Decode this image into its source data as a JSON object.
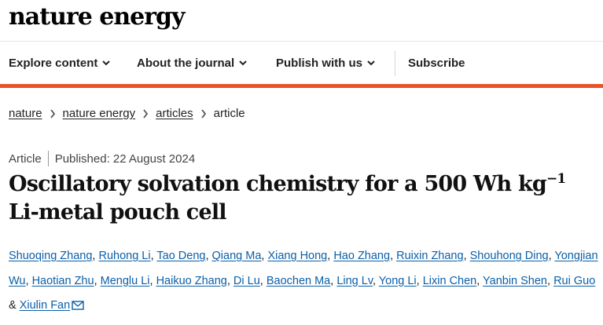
{
  "brand": {
    "logo_text": "nature energy"
  },
  "nav": {
    "items": [
      {
        "label": "Explore content",
        "has_dropdown": true
      },
      {
        "label": "About the journal",
        "has_dropdown": true
      },
      {
        "label": "Publish with us",
        "has_dropdown": true
      }
    ],
    "subscribe_label": "Subscribe"
  },
  "colors": {
    "accent": "#e8532a",
    "link": "#0c5fa8"
  },
  "breadcrumb": {
    "links": [
      "nature",
      "nature energy",
      "articles"
    ],
    "current": "article"
  },
  "article": {
    "type": "Article",
    "published": "Published: 22 August 2024",
    "title_main": "Oscillatory solvation chemistry for a 500 Wh kg",
    "title_sup": "−1",
    "title_tail": " Li-metal pouch cell",
    "authors": [
      "Shuoqing Zhang",
      "Ruhong Li",
      "Tao Deng",
      "Qiang Ma",
      "Xiang Hong",
      "Hao Zhang",
      "Ruixin Zhang",
      "Shouhong Ding",
      "Yongjian Wu",
      "Haotian Zhu",
      "Menglu Li",
      "Haikuo Zhang",
      "Di Lu",
      "Baochen Ma",
      "Ling Lv",
      "Yong Li",
      "Lixin Chen",
      "Yanbin Shen",
      "Rui Guo",
      "Xiulin Fan"
    ],
    "author_separator": ", ",
    "last_separator": " & ",
    "corresponding_icon": "envelope-icon"
  }
}
